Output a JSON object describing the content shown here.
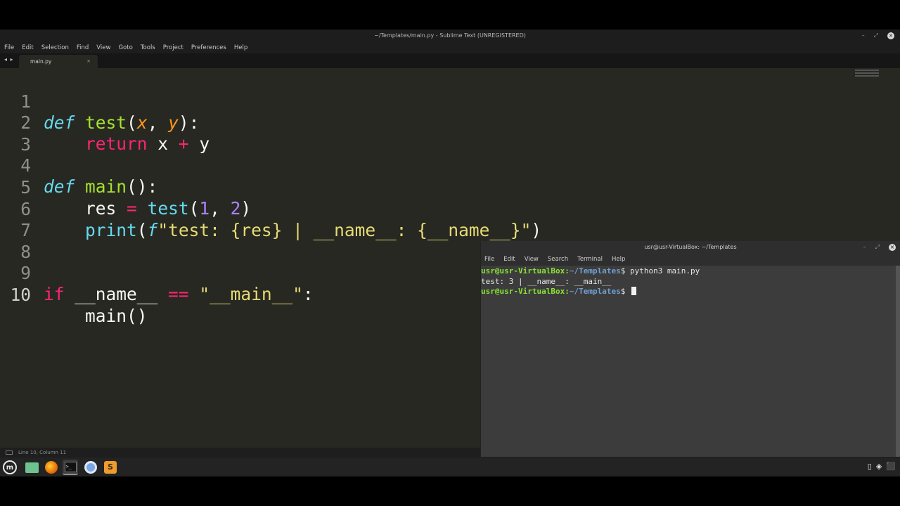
{
  "sublime": {
    "window_title": "~/Templates/main.py - Sublime Text (UNREGISTERED)",
    "menu": [
      "File",
      "Edit",
      "Selection",
      "Find",
      "View",
      "Goto",
      "Tools",
      "Project",
      "Preferences",
      "Help"
    ],
    "tab": {
      "label": "main.py",
      "close": "×",
      "nav": "◂ ▸"
    },
    "status": "Line 10, Column 11",
    "window_controls": {
      "minimize": "–",
      "maximize": "⤢",
      "close": "×"
    },
    "line_numbers": [
      "1",
      "2",
      "3",
      "4",
      "5",
      "6",
      "7",
      "8",
      "9",
      "10"
    ],
    "code": {
      "l1": {
        "def": "def",
        "fname": "test",
        "open": "(",
        "p1": "x",
        "comma": ", ",
        "p2": "y",
        "close": "):"
      },
      "l2": {
        "indent": "    ",
        "ret": "return",
        "expr": " x ",
        "plus": "+",
        "y": " y"
      },
      "l4": {
        "def": "def",
        "fname": "main",
        "rest": "():"
      },
      "l5": {
        "indent": "    ",
        "var": "res ",
        "eq": "=",
        "sp": " ",
        "call": "test",
        "open": "(",
        "n1": "1",
        "comma": ", ",
        "n2": "2",
        "close": ")"
      },
      "l6": {
        "indent": "    ",
        "print": "print",
        "open": "(",
        "fprefix": "f",
        "fstr": "\"test: {res} | __name__: {__name__}\"",
        "close": ")"
      },
      "l9": {
        "if": "if",
        "name": " __name__ ",
        "eq": "==",
        "sp": " ",
        "str": "\"__main__\"",
        "colon": ":"
      },
      "l10": {
        "indent": "    ",
        "call": "main()"
      }
    }
  },
  "terminal": {
    "title": "usr@usr-VirtualBox: ~/Templates",
    "menu": [
      "File",
      "Edit",
      "View",
      "Search",
      "Terminal",
      "Help"
    ],
    "lines": [
      {
        "user": "usr@usr-VirtualBox",
        "sep": ":",
        "path": "~/Templates",
        "dollar": "$ ",
        "cmd": "python3 main.py"
      },
      {
        "output": "test: 3 | __name__: __main__"
      },
      {
        "user": "usr@usr-VirtualBox",
        "sep": ":",
        "path": "~/Templates",
        "dollar": "$ ",
        "cmd": ""
      }
    ]
  },
  "taskbar": {
    "items": [
      "menu-icon",
      "files-icon",
      "firefox-icon",
      "terminal-icon",
      "chromium-icon",
      "sublime-icon"
    ],
    "menu_glyph": "m",
    "terminal_glyph": ">_",
    "sublime_glyph": "S",
    "tray": [
      "▯",
      "◈",
      "⬛"
    ]
  },
  "colors": {
    "editor_bg": "#272822",
    "keyword_def": "#66d9ef",
    "function": "#a6e22e",
    "param": "#fd971f",
    "keyword": "#f92672",
    "number": "#ae81ff",
    "string": "#e6db74",
    "prompt": "#8ae234",
    "path": "#729fcf"
  }
}
